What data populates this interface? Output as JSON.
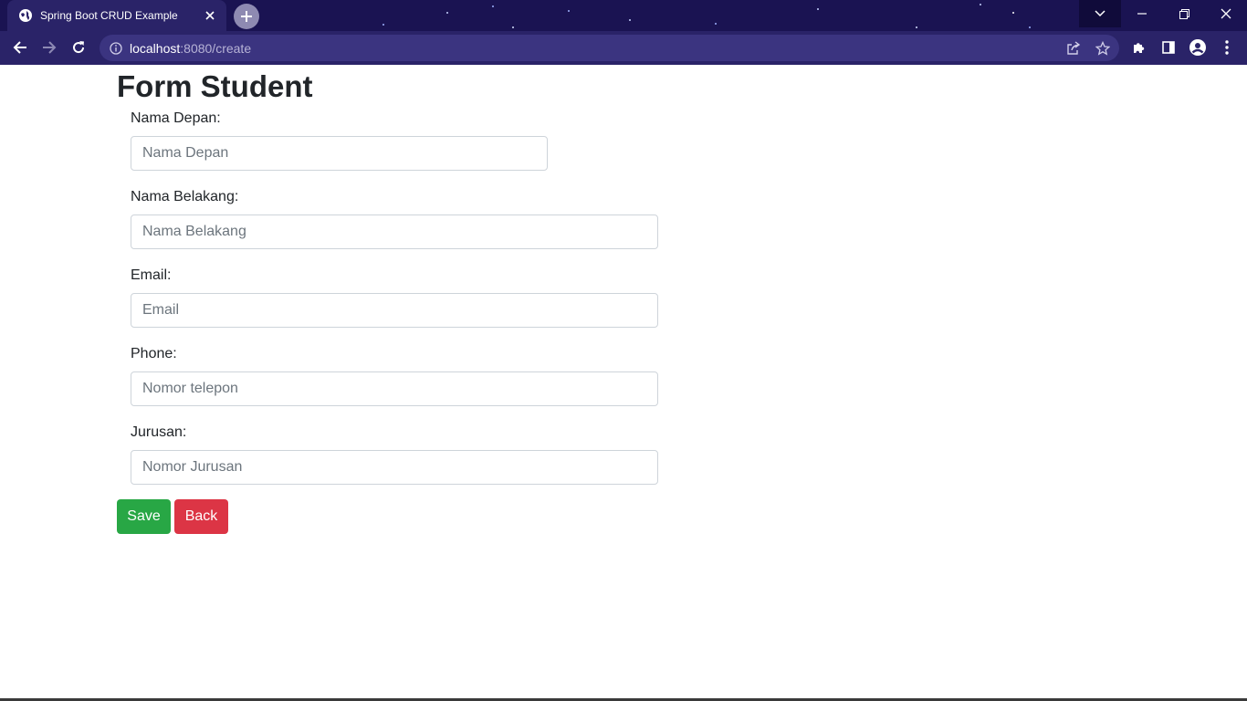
{
  "browser": {
    "tab_title": "Spring Boot CRUD Example",
    "url_host": "localhost",
    "url_path": ":8080/create",
    "icons": {
      "favicon": "globe-icon",
      "tab_close": "close-icon",
      "new_tab": "plus-icon",
      "back": "arrow-left-icon",
      "forward": "arrow-right-icon",
      "reload": "reload-icon",
      "site_info": "info-icon",
      "share": "share-icon",
      "bookmark": "star-icon",
      "extensions": "puzzle-icon",
      "side_panel": "side-panel-icon",
      "profile": "profile-icon",
      "menu": "kebab-menu-icon",
      "tab_search": "chevron-down-icon",
      "minimize": "minimize-icon",
      "restore": "restore-icon",
      "close_window": "close-icon"
    },
    "colors": {
      "tabbar_bg": "#1a1352",
      "toolbar_bg": "#2a2368",
      "omnibox_bg": "#3b3480"
    }
  },
  "form": {
    "title": "Form Student",
    "fields": [
      {
        "label": "Nama Depan:",
        "placeholder": "Nama Depan",
        "value": ""
      },
      {
        "label": "Nama Belakang:",
        "placeholder": "Nama Belakang",
        "value": ""
      },
      {
        "label": "Email:",
        "placeholder": "Email",
        "value": ""
      },
      {
        "label": "Phone:",
        "placeholder": "Nomor telepon",
        "value": ""
      },
      {
        "label": "Jurusan:",
        "placeholder": "Nomor Jurusan",
        "value": ""
      }
    ],
    "buttons": {
      "save_label": "Save",
      "back_label": "Back"
    },
    "colors": {
      "save": "#28a745",
      "back": "#dc3545"
    }
  }
}
